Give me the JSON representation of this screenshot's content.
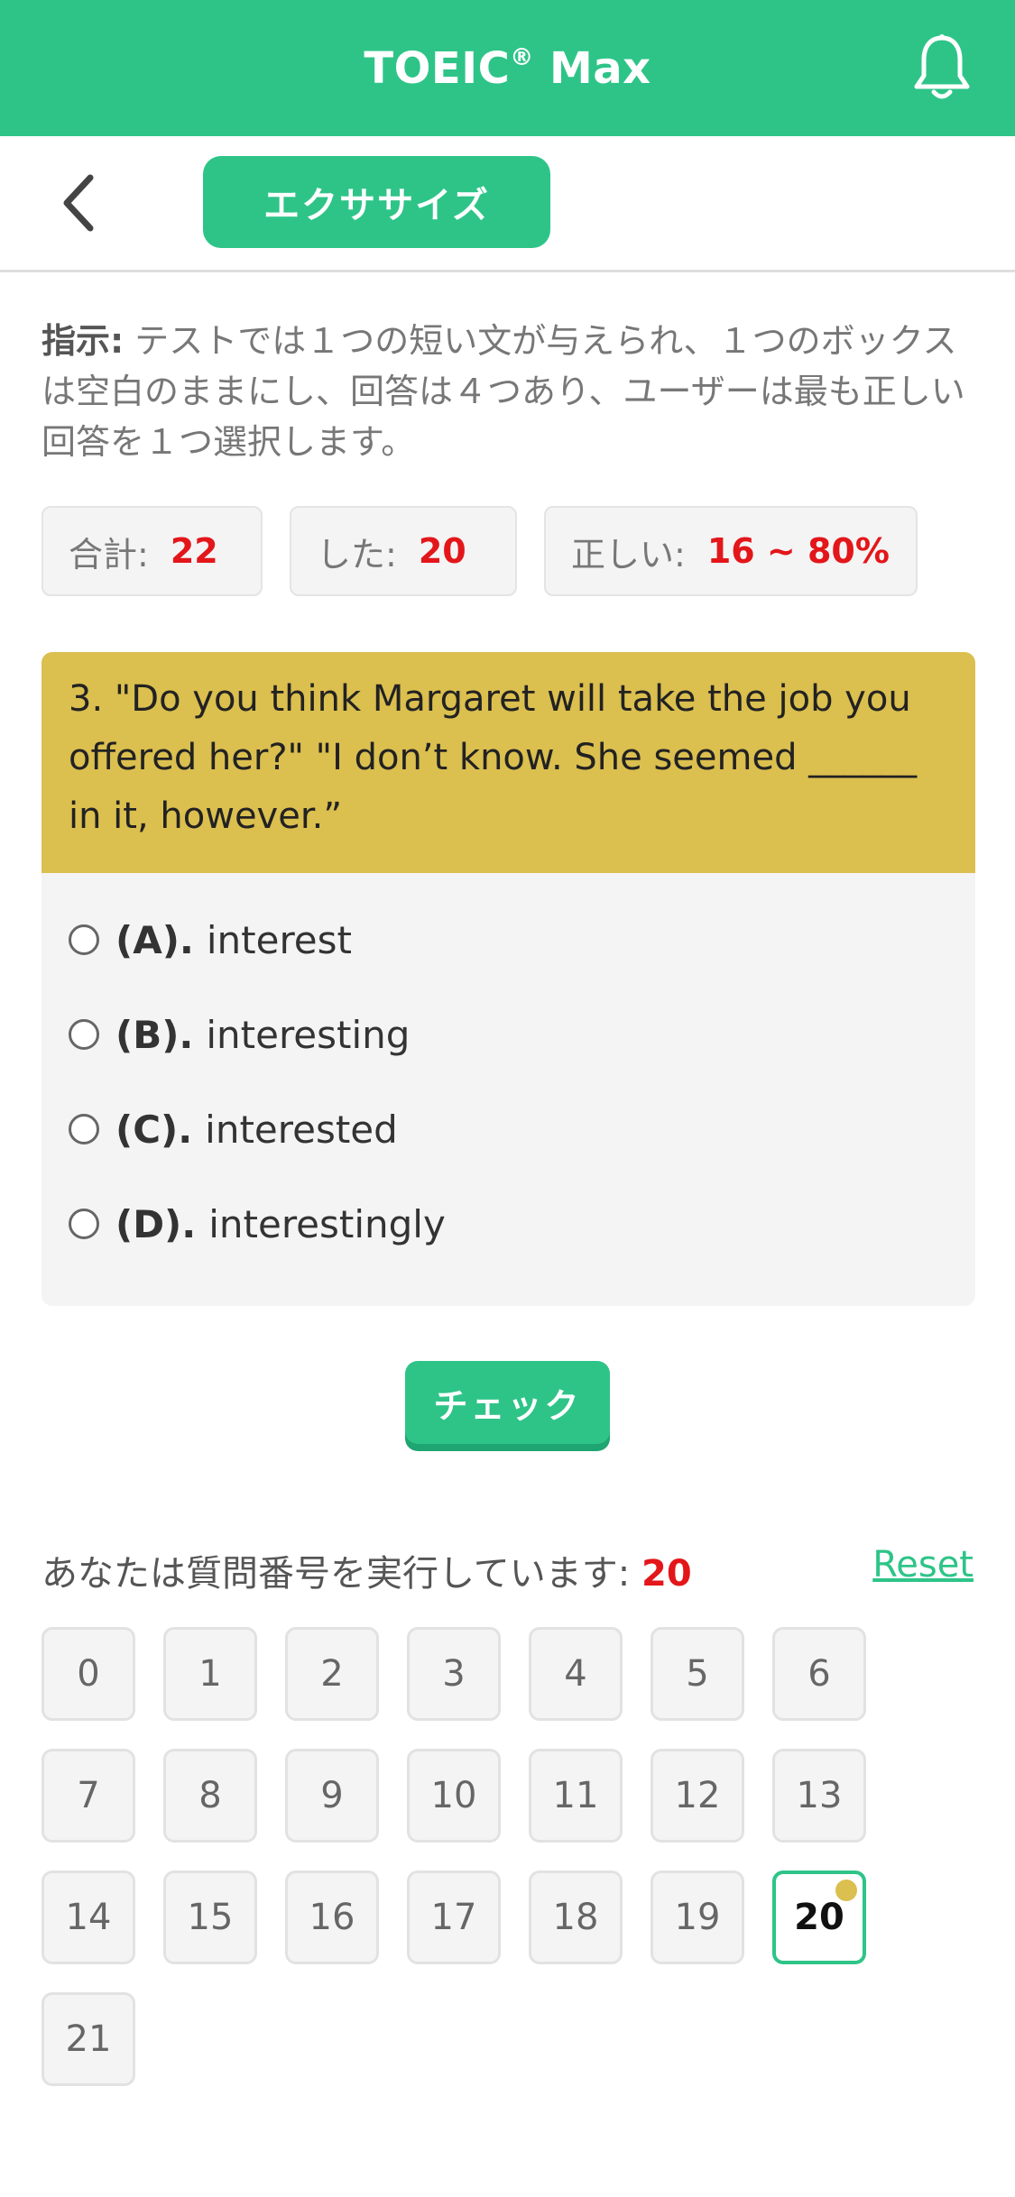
{
  "header": {
    "title_main": "TOEIC",
    "title_mark": "®",
    "title_suffix": " Max",
    "bell_icon": "bell-icon"
  },
  "subbar": {
    "back_icon": "chevron-left-icon",
    "mode_label": "エクササイズ"
  },
  "instruction": {
    "label": "指示:",
    "text": " テストでは１つの短い文が与えられ、１つのボックスは空白のままにし、回答は４つあり、ユーザーは最も正しい回答を１つ選択します。"
  },
  "stats": {
    "total_label": "合計:",
    "total_value": "22",
    "done_label": "した:",
    "done_value": "20",
    "correct_label": "正しい:",
    "correct_value": "16 ~ 80%"
  },
  "question": {
    "text": "3. \"Do you think Margaret will take the job you offered her?\" \"I don’t know. She seemed ______ in it, however.”"
  },
  "options": [
    {
      "letter": "(A).",
      "text": "interest"
    },
    {
      "letter": "(B).",
      "text": "interesting"
    },
    {
      "letter": "(C).",
      "text": "interested"
    },
    {
      "letter": "(D).",
      "text": "interestingly"
    }
  ],
  "check_button": "チェック",
  "progress": {
    "label": "あなたは質問番号を実行しています: ",
    "current": "20",
    "reset_label": "Reset"
  },
  "question_numbers": [
    "0",
    "1",
    "2",
    "3",
    "4",
    "5",
    "6",
    "7",
    "8",
    "9",
    "10",
    "11",
    "12",
    "13",
    "14",
    "15",
    "16",
    "17",
    "18",
    "19",
    "20",
    "21"
  ],
  "active_number": "20",
  "colors": {
    "brand_green": "#2ec488",
    "question_bg": "#dbbf4f",
    "highlight_red": "#e3161a"
  }
}
